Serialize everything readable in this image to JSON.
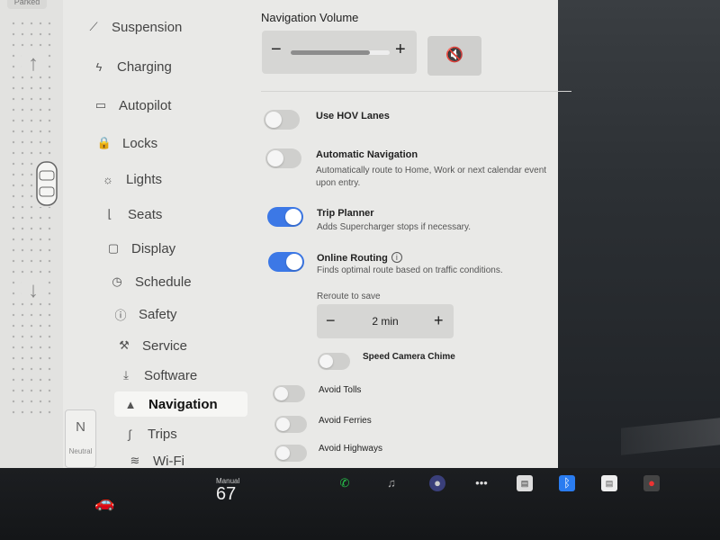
{
  "car_strip": {
    "parked_label": "Parked",
    "gear_letter": "N",
    "gear_label": "Neutral"
  },
  "menu": {
    "items": [
      {
        "label": "Suspension",
        "icon": "suspension-icon",
        "glyph": "⟋"
      },
      {
        "label": "Charging",
        "icon": "lightning-icon",
        "glyph": "ϟ"
      },
      {
        "label": "Autopilot",
        "icon": "steering-icon",
        "glyph": "▭"
      },
      {
        "label": "Locks",
        "icon": "lock-icon",
        "glyph": "🔒"
      },
      {
        "label": "Lights",
        "icon": "sun-icon",
        "glyph": "☼"
      },
      {
        "label": "Seats",
        "icon": "seat-icon",
        "glyph": "⌊"
      },
      {
        "label": "Display",
        "icon": "display-icon",
        "glyph": "▢"
      },
      {
        "label": "Schedule",
        "icon": "clock-icon",
        "glyph": "◷"
      },
      {
        "label": "Safety",
        "icon": "safety-icon",
        "glyph": "ⓘ"
      },
      {
        "label": "Service",
        "icon": "wrench-icon",
        "glyph": "⚒"
      },
      {
        "label": "Software",
        "icon": "download-icon",
        "glyph": "⤓"
      },
      {
        "label": "Navigation",
        "icon": "navigation-icon",
        "glyph": "▲"
      },
      {
        "label": "Trips",
        "icon": "trips-icon",
        "glyph": "∫"
      },
      {
        "label": "Wi-Fi",
        "icon": "wifi-icon",
        "glyph": "≋"
      }
    ],
    "active": "Navigation"
  },
  "panel": {
    "nav_volume_title": "Navigation Volume",
    "volume_level": 0.8,
    "minus_glyph": "−",
    "plus_glyph": "+",
    "mute_glyph": "🔇",
    "options": [
      {
        "label": "Use HOV Lanes",
        "on": false,
        "desc": ""
      },
      {
        "label": "Automatic Navigation",
        "on": false,
        "desc": "Automatically route to Home, Work or next calendar event upon entry."
      },
      {
        "label": "Trip Planner",
        "on": true,
        "desc": "Adds Supercharger stops if necessary."
      },
      {
        "label": "Online Routing",
        "on": true,
        "desc": "Finds optimal route based on traffic conditions."
      }
    ],
    "info_glyph": "i",
    "reroute_label": "Reroute to save",
    "reroute_value": "2 min",
    "speed_camera_label": "Speed Camera Chime",
    "speed_camera_on": false,
    "avoid": [
      {
        "label": "Avoid Tolls",
        "on": false
      },
      {
        "label": "Avoid Ferries",
        "on": false
      },
      {
        "label": "Avoid Highways",
        "on": false
      }
    ]
  },
  "bottom_bar": {
    "speed_mode": "Manual",
    "speed": "67",
    "car_glyph": "🚗",
    "dock": [
      {
        "name": "phone-icon",
        "glyph": "✆"
      },
      {
        "name": "music-icon",
        "glyph": "♫"
      },
      {
        "name": "camera-icon",
        "glyph": "●"
      },
      {
        "name": "more-icon",
        "glyph": "•••"
      },
      {
        "name": "toybox-icon",
        "glyph": "▤"
      },
      {
        "name": "bluetooth-icon",
        "glyph": "ᛒ"
      },
      {
        "name": "notes-icon",
        "glyph": "▤"
      },
      {
        "name": "dashcam-icon",
        "glyph": "●"
      }
    ]
  },
  "colors": {
    "toggle_on": "#3c78e6",
    "toggle_off": "#cfcfcd",
    "screen_bg": "#e9e9e7"
  }
}
